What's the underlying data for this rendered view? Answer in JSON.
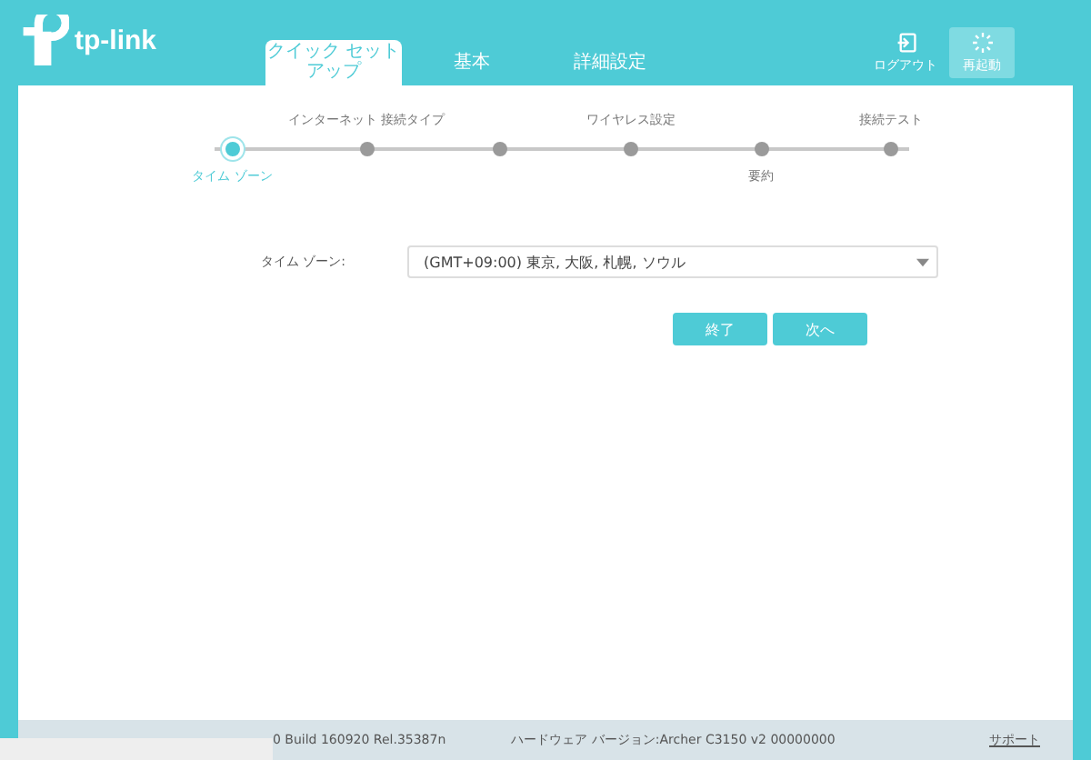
{
  "brand": {
    "name": "tp-link"
  },
  "tabs": [
    {
      "label": "クイック セットアップ",
      "selected": true
    },
    {
      "label": "基本",
      "selected": false
    },
    {
      "label": "詳細設定",
      "selected": false
    }
  ],
  "header_actions": [
    {
      "kind": "logout",
      "label": "ログアウト",
      "selected": false
    },
    {
      "kind": "restart",
      "label": "再起動",
      "selected": true
    }
  ],
  "steps": [
    {
      "kind": "below",
      "label": "タイム ゾーン",
      "selected": true
    },
    {
      "kind": "above",
      "label": "インターネット 接続タイプ",
      "selected": false
    },
    {
      "kind": "plain",
      "selected": false
    },
    {
      "kind": "above",
      "label": "ワイヤレス設定",
      "selected": false
    },
    {
      "kind": "below",
      "label": "要約",
      "selected": false
    },
    {
      "kind": "above",
      "label": "接続テスト",
      "selected": false
    }
  ],
  "form": {
    "label": "タイム ゾーン:",
    "value": "(GMT+09:00) 東京, 大阪, 札幌, ソウル"
  },
  "buttons": [
    "終了",
    "次へ"
  ],
  "footer": {
    "firmware": "0 Build 160920 Rel.35387n",
    "hardware": "ハードウェア バージョン:Archer C3150 v2 00000000",
    "support": "サポート"
  }
}
